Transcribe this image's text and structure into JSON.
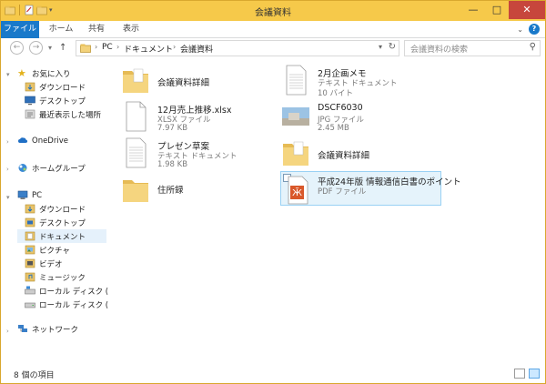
{
  "window": {
    "title": "会議資料"
  },
  "ribbon": {
    "tabs": [
      "ファイル",
      "ホーム",
      "共有",
      "表示"
    ]
  },
  "address": {
    "crumbs": [
      "PC",
      "ドキュメント",
      "会議資料"
    ]
  },
  "search": {
    "placeholder": "会議資料の検索"
  },
  "nav": {
    "favorites": "お気に入り",
    "fav_items": [
      "ダウンロード",
      "デスクトップ",
      "最近表示した場所"
    ],
    "onedrive": "OneDrive",
    "homegroup": "ホームグループ",
    "pc": "PC",
    "pc_items": [
      "ダウンロード",
      "デスクトップ",
      "ドキュメント",
      "ピクチャ",
      "ビデオ",
      "ミュージック",
      "ローカル ディスク (C:)",
      "ローカル ディスク (D:)"
    ],
    "network": "ネットワーク"
  },
  "files": [
    {
      "name": "会議資料詳細",
      "type": "",
      "size": "",
      "icon": "folder-icon"
    },
    {
      "name": "2月企画メモ",
      "type": "テキスト ドキュメント",
      "size": "10 バイト",
      "icon": "text-file-icon"
    },
    {
      "name": "12月売上推移.xlsx",
      "type": "XLSX ファイル",
      "size": "7.97 KB",
      "icon": "blank-file-icon"
    },
    {
      "name": "DSCF6030",
      "type": "JPG ファイル",
      "size": "2.45 MB",
      "icon": "photo-thumbnail-icon"
    },
    {
      "name": "プレゼン草案",
      "type": "テキスト ドキュメント",
      "size": "1.98 KB",
      "icon": "text-file-icon"
    },
    {
      "name": "会議資料詳細",
      "type": "",
      "size": "",
      "icon": "folder-icon"
    },
    {
      "name": "住所録",
      "type": "",
      "size": "",
      "icon": "folder-icon"
    },
    {
      "name": "平成24年版 情報通信白書のポイント",
      "type": "PDF ファイル",
      "size": "",
      "icon": "pdf-file-icon"
    }
  ],
  "status": {
    "text": "8 個の項目"
  },
  "colors": {
    "titlebar": "#f6c94a",
    "file_tab": "#1979ca",
    "close": "#c7463c",
    "selection": "#99d1f4"
  }
}
